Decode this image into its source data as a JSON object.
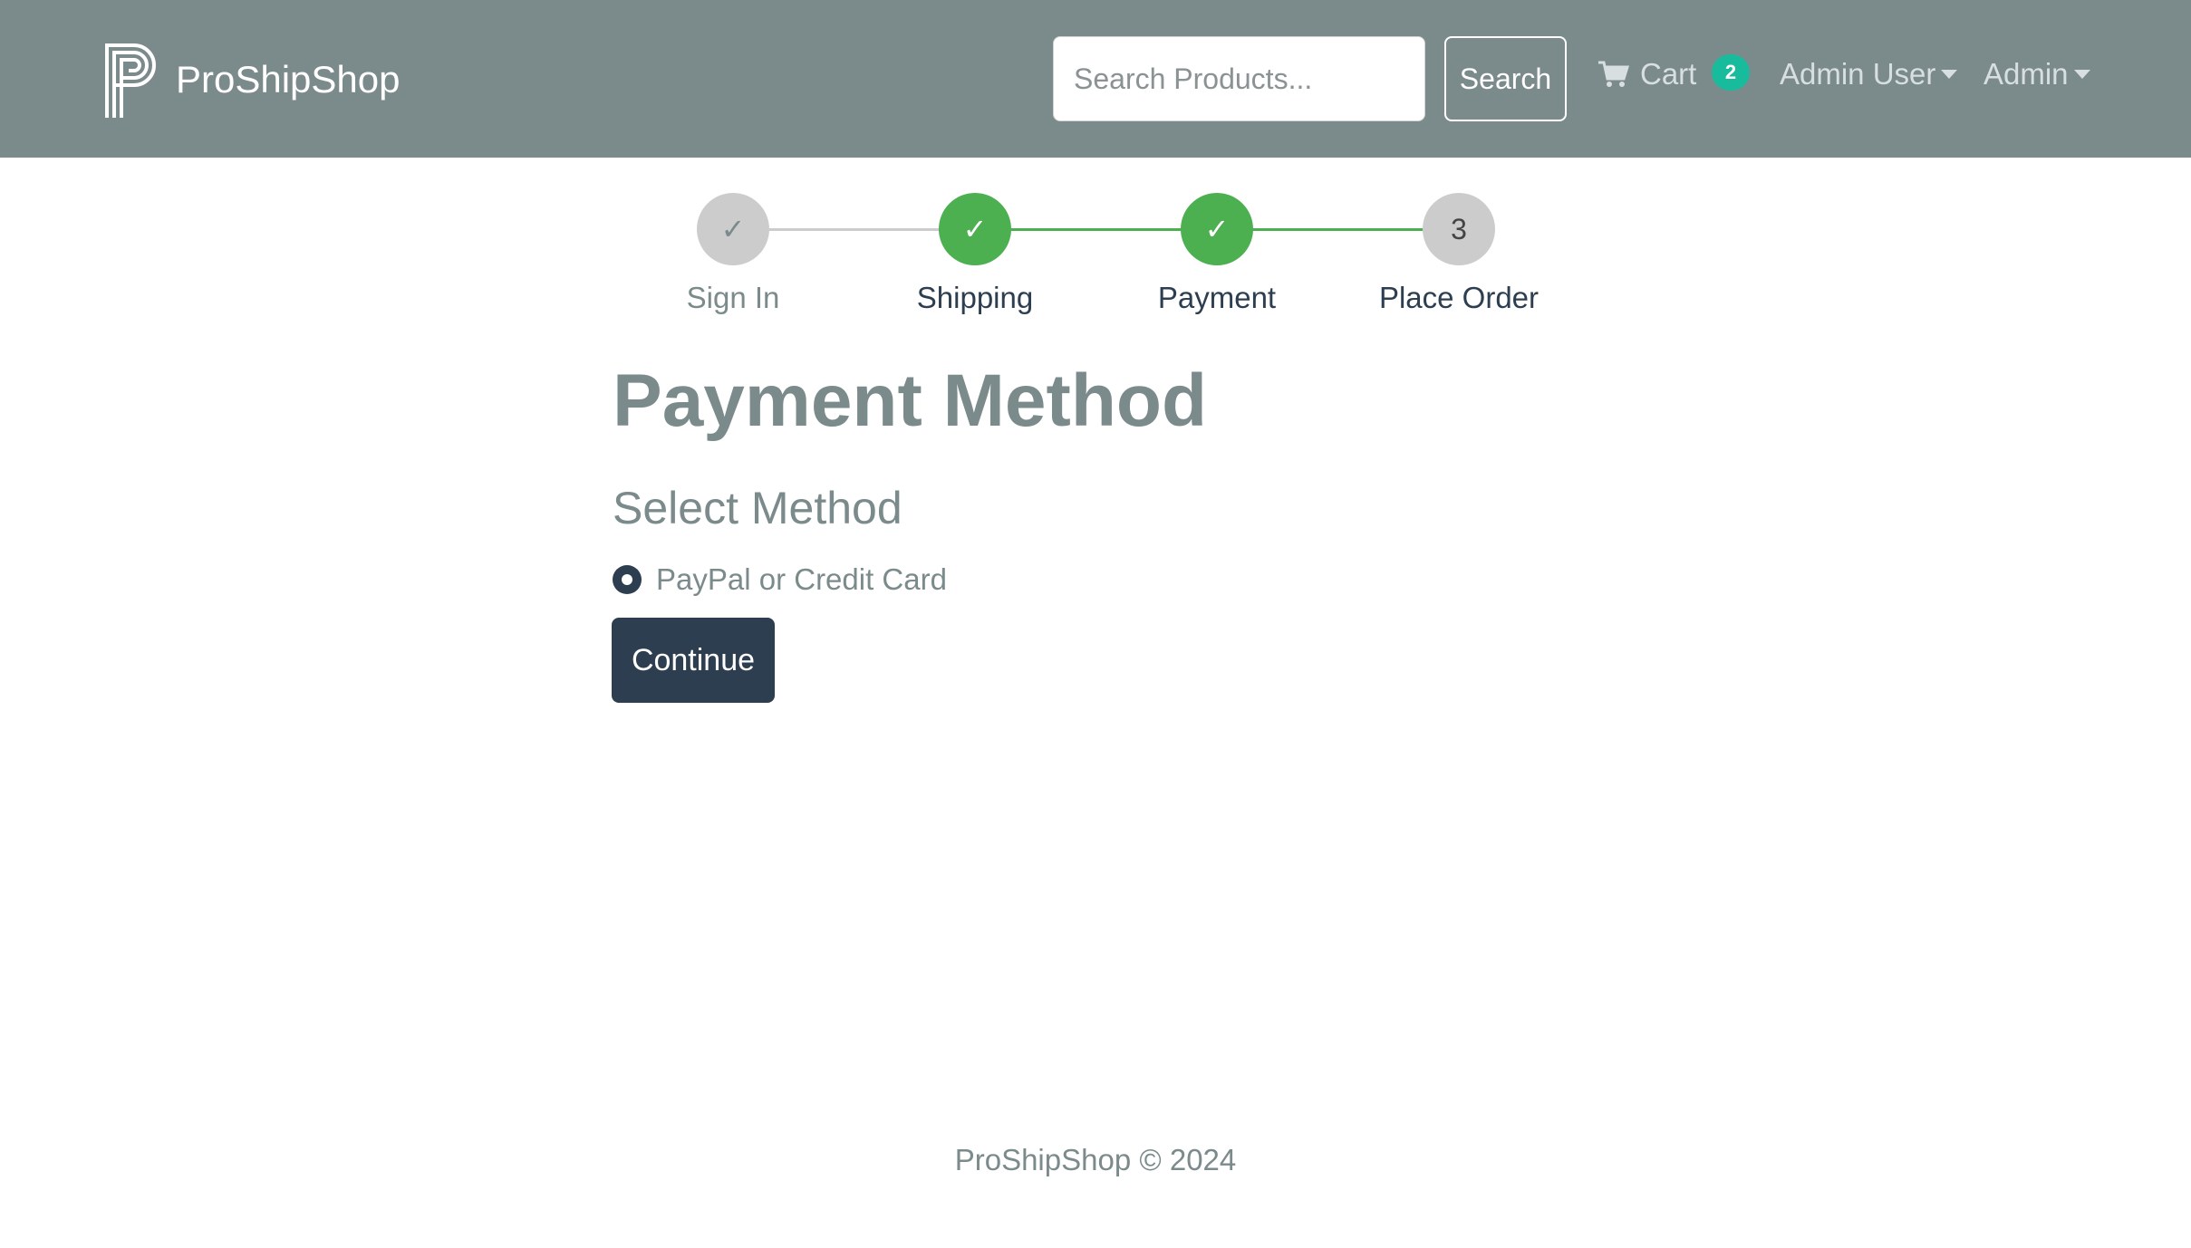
{
  "navbar": {
    "brand_name": "ProShipShop",
    "logo_icon": "proshipshop-logo",
    "search_placeholder": "Search Products...",
    "search_value": "",
    "search_button_label": "Search",
    "cart_icon": "shopping-cart-icon",
    "cart_label": "Cart",
    "cart_count": "2",
    "user_menu_label": "Admin User",
    "admin_menu_label": "Admin"
  },
  "steps": [
    {
      "label": "Sign In",
      "state": "disabled",
      "marker": "✓"
    },
    {
      "label": "Shipping",
      "state": "completed",
      "marker": "✓"
    },
    {
      "label": "Payment",
      "state": "completed",
      "marker": "✓"
    },
    {
      "label": "Place Order",
      "state": "upcoming",
      "marker": "3"
    }
  ],
  "main": {
    "title": "Payment Method",
    "section_title": "Select Method",
    "payment_options": [
      {
        "label": "PayPal or Credit Card",
        "selected": true
      }
    ],
    "continue_label": "Continue"
  },
  "footer": {
    "text": "ProShipShop © 2024"
  },
  "colors": {
    "navbar_bg": "#7b8a8b",
    "primary": "#2c3e50",
    "success": "#4caf50",
    "badge": "#18bc9c",
    "muted_text": "#7b8a8b",
    "step_inactive": "#cccccc"
  }
}
